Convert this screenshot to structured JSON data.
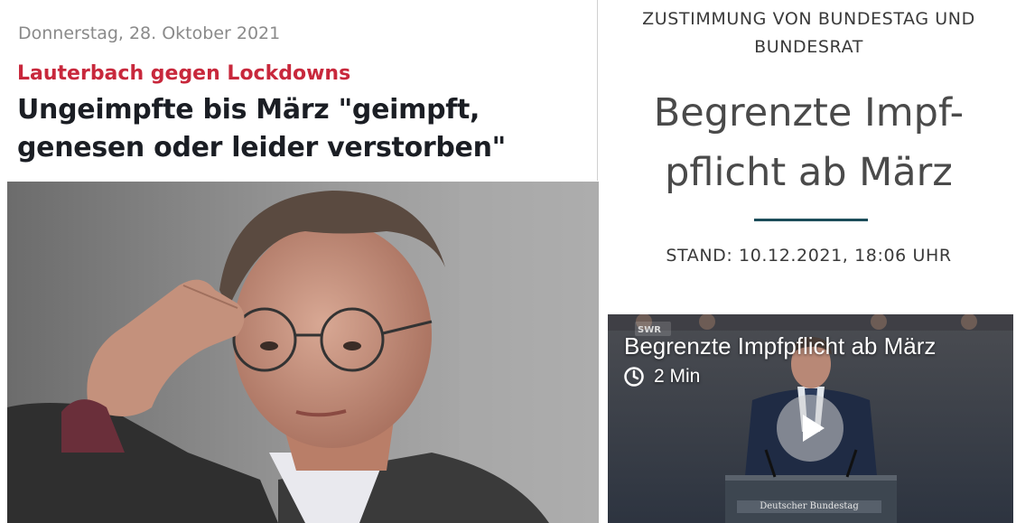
{
  "left": {
    "date": "Donnerstag, 28. Oktober 2021",
    "kicker": "Lauterbach gegen Lockdowns",
    "headline": "Ungeimpfte bis März \"geimpft, genesen oder leider verstorben\"",
    "photo_icon": "portrait-photo"
  },
  "right": {
    "kicker": "ZUSTIMMUNG VON BUNDESTAG UND BUNDESRAT",
    "headline_line1": "Begrenzte Impf-",
    "headline_line2": "pflicht ab März",
    "stand": "STAND: 10.12.2021, 18:06 UHR",
    "video": {
      "title": "Begrenzte Impfpflicht ab März",
      "duration": "2 Min",
      "duration_icon": "clock-icon",
      "play_icon": "play-icon",
      "podium_sign": "Deutscher Bundestag"
    }
  },
  "colors": {
    "kicker_red": "#c8283c",
    "headline_dark": "#1b1e24",
    "rule_teal": "#1c4d5a"
  }
}
